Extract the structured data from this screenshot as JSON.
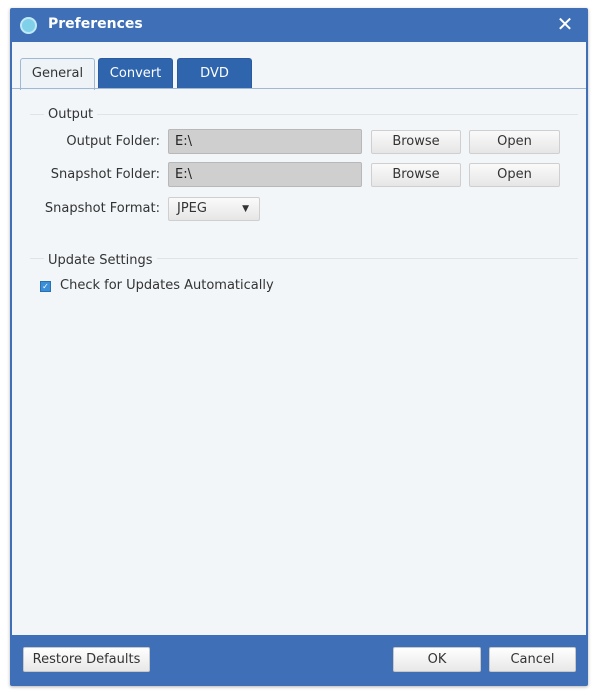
{
  "window": {
    "title": "Preferences",
    "icon": "app-film-reel-icon",
    "close_icon": "close-icon"
  },
  "tabs": [
    {
      "label": "General",
      "active": true
    },
    {
      "label": "Convert",
      "active": false
    },
    {
      "label": "DVD",
      "active": false
    }
  ],
  "output": {
    "section_label": "Output",
    "output_folder": {
      "label": "Output Folder:",
      "value": "E:\\",
      "browse": "Browse",
      "open": "Open"
    },
    "snapshot_folder": {
      "label": "Snapshot Folder:",
      "value": "E:\\",
      "browse": "Browse",
      "open": "Open"
    },
    "snapshot_format": {
      "label": "Snapshot Format:",
      "value": "JPEG"
    }
  },
  "update": {
    "section_label": "Update Settings",
    "check_label": "Check for Updates Automatically",
    "checked": true
  },
  "footer": {
    "restore": "Restore Defaults",
    "ok": "OK",
    "cancel": "Cancel"
  },
  "colors": {
    "accent": "#3f70b7",
    "panel": "#f2f6f9"
  }
}
